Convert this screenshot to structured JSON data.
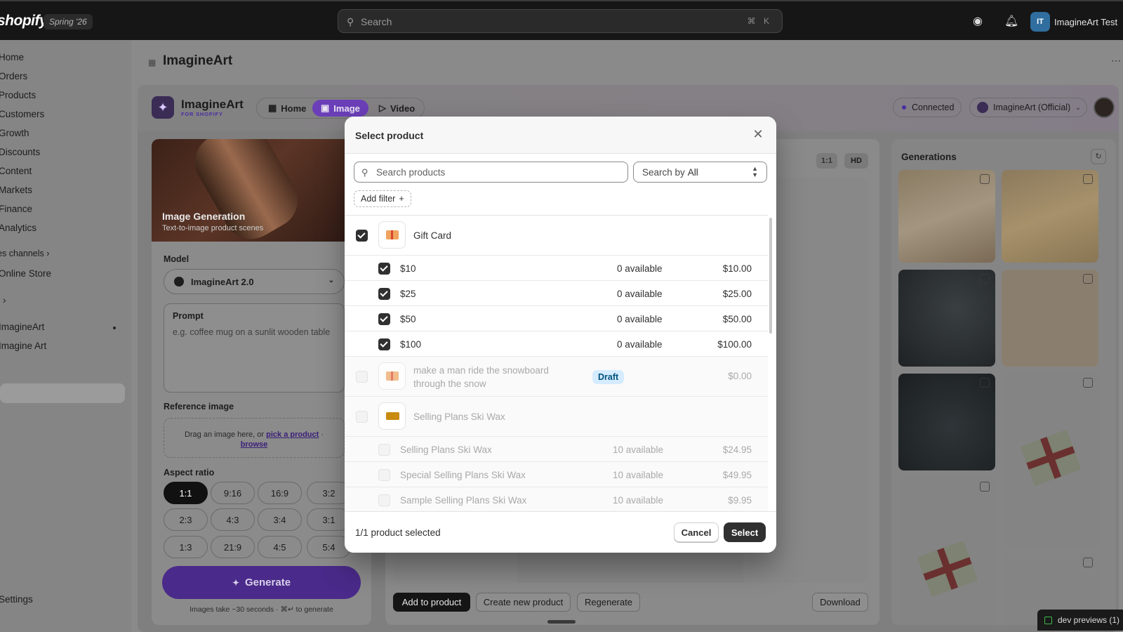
{
  "topbar": {
    "logo": "shopify",
    "season": "Spring '26",
    "search_placeholder": "Search",
    "search_shortcut": "⌘ K",
    "account_initials": "IT",
    "account_name": "ImagineArt Test"
  },
  "sidebar": {
    "items": [
      "Home",
      "Orders",
      "Products",
      "Customers",
      "Growth",
      "Discounts",
      "Content",
      "Markets",
      "Finance",
      "Analytics"
    ],
    "sales_channels": "Sales channels",
    "online_store": "Online Store",
    "apps_chevron": "›",
    "app_items": [
      "ImagineArt",
      "Imagine Art"
    ],
    "settings": "Settings"
  },
  "page": {
    "title": "ImagineArt",
    "more": "⋯"
  },
  "app": {
    "brand": "ImagineArt",
    "brand_sub": "FOR SHOPIFY",
    "nav": [
      "Home",
      "Image",
      "Video"
    ],
    "connected": "Connected",
    "account": "ImagineArt (Official)"
  },
  "left_panel": {
    "hero_title": "Image Generation",
    "hero_sub": "Text-to-image product scenes",
    "model_label": "Model",
    "model_value": "ImagineArt 2.0",
    "prompt_label": "Prompt",
    "prompt_placeholder": "e.g. coffee mug on a sunlit wooden table",
    "reference_label": "Reference image",
    "reference_text": "Drag an image here, or",
    "reference_link1": "pick a product",
    "reference_sep": "·",
    "reference_link2": "browse",
    "aspect_label": "Aspect ratio",
    "aspect_ratios": [
      "1:1",
      "9:16",
      "16:9",
      "3:2",
      "2:3",
      "4:3",
      "3:4",
      "3:1",
      "1:3",
      "21:9",
      "4:5",
      "5:4"
    ],
    "aspect_selected": "1:1",
    "generate": "Generate",
    "generate_tip": "Images take ~30 seconds · ⌘↵ to generate"
  },
  "center": {
    "ratio_tag": "1:1",
    "hd_tag": "HD",
    "buttons": [
      "Add to product",
      "Create new product",
      "Regenerate",
      "Download"
    ]
  },
  "generations": {
    "title": "Generations"
  },
  "dev_previews": "dev previews (1)",
  "modal": {
    "title": "Select product",
    "search_placeholder": "Search products",
    "search_by_label": "Search by",
    "search_by_value": "All",
    "add_filter": "Add filter",
    "rows": [
      {
        "type": "product",
        "name": "Gift Card",
        "checked": true,
        "thumb": "gift-card"
      },
      {
        "type": "variant",
        "name": "$10",
        "available": "0 available",
        "price": "$10.00",
        "checked": true
      },
      {
        "type": "variant",
        "name": "$25",
        "available": "0 available",
        "price": "$25.00",
        "checked": true
      },
      {
        "type": "variant",
        "name": "$50",
        "available": "0 available",
        "price": "$50.00",
        "checked": true
      },
      {
        "type": "variant",
        "name": "$100",
        "available": "0 available",
        "price": "$100.00",
        "checked": true
      },
      {
        "type": "product",
        "name_line1": "make a man ride the snowboard",
        "name_line2": "through the snow",
        "badge": "Draft",
        "price": "$0.00",
        "disabled": true,
        "thumb": "gift-card"
      },
      {
        "type": "product",
        "name": "Selling Plans Ski Wax",
        "disabled": true,
        "thumb": "ski-wax"
      },
      {
        "type": "variant",
        "name": "Selling Plans Ski Wax",
        "available": "10 available",
        "price": "$24.95",
        "disabled": true
      },
      {
        "type": "variant",
        "name": "Special Selling Plans Ski Wax",
        "available": "10 available",
        "price": "$49.95",
        "disabled": true
      },
      {
        "type": "variant",
        "name": "Sample Selling Plans Ski Wax",
        "available": "10 available",
        "price": "$9.95",
        "disabled": true
      }
    ],
    "selected_count": "1/1 product selected",
    "cancel": "Cancel",
    "select": "Select"
  }
}
